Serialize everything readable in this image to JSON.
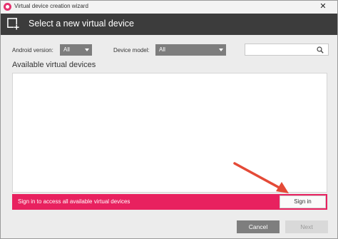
{
  "window": {
    "title": "Virtual device creation wizard",
    "close_glyph": "✕"
  },
  "header": {
    "title": "Select a new virtual device"
  },
  "filters": {
    "android_label": "Android version:",
    "android_value": "All",
    "device_label": "Device model:",
    "device_value": "All",
    "search_placeholder": ""
  },
  "list": {
    "title": "Available virtual devices"
  },
  "signin_bar": {
    "text": "Sign in to access all available virtual devices",
    "button_label": "Sign in"
  },
  "footer": {
    "cancel_label": "Cancel",
    "next_label": "Next"
  },
  "colors": {
    "accent": "#e8215f",
    "header_bg": "#3c3c3c",
    "annotation_arrow": "#e44a37"
  }
}
